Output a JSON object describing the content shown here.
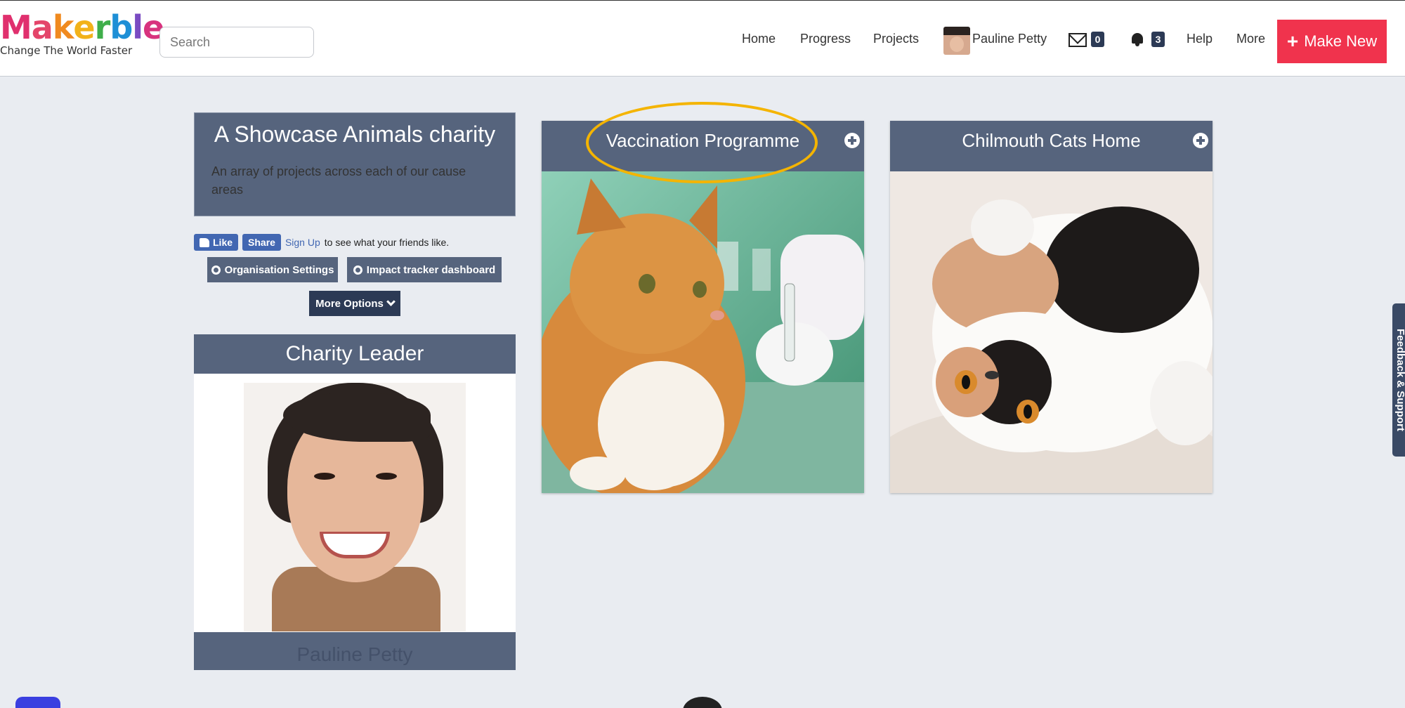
{
  "header": {
    "logo_word": "Makerble",
    "logo_tagline": "Change The World Faster",
    "search_placeholder": "Search",
    "nav": {
      "home": "Home",
      "progress": "Progress",
      "projects": "Projects",
      "user_name": "Pauline Petty",
      "messages_count": "0",
      "notifications_count": "3",
      "help": "Help",
      "more": "More"
    },
    "make_new_label": "Make New"
  },
  "organisation": {
    "title": "A Showcase Animals charity",
    "description": "An array of projects across each of our cause areas"
  },
  "social": {
    "like_label": "Like",
    "share_label": "Share",
    "signup_label": "Sign Up",
    "prompt_text": "to see what your friends like."
  },
  "buttons": {
    "org_settings": "Organisation Settings",
    "impact_dashboard": "Impact tracker dashboard",
    "more_options": "More Options"
  },
  "leader": {
    "heading": "Charity Leader",
    "name": "Pauline Petty"
  },
  "projects": [
    {
      "title": "Vaccination Programme"
    },
    {
      "title": "Chilmouth Cats Home"
    }
  ],
  "feedback_tab_label": "Feedback & Support",
  "colors": {
    "brand_red": "#f0334d",
    "card_slate": "#56647d",
    "navy": "#2c3a55",
    "highlight": "#f4b400",
    "background": "#e9ecf1"
  }
}
